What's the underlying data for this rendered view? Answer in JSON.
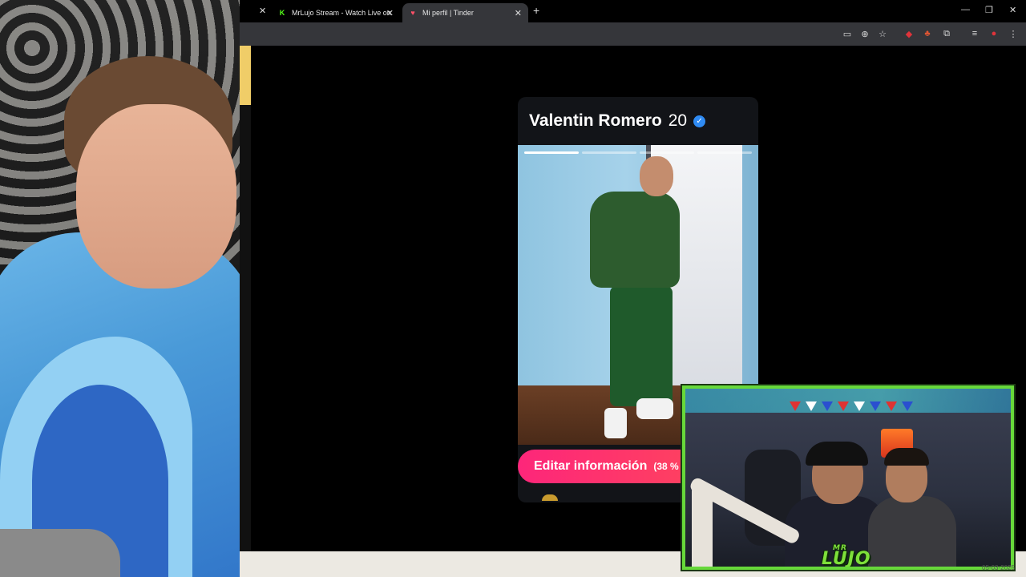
{
  "browser": {
    "tabs": [
      {
        "title": "MrLujo Stream - Watch Live on",
        "icon": "kick-icon",
        "active": false
      },
      {
        "title": "Mi perfil | Tinder",
        "icon": "tinder-icon",
        "active": true
      }
    ],
    "new_tab_label": "+"
  },
  "profile": {
    "name": "Valentin Romero",
    "age": "20",
    "verified": true,
    "edit_button_label": "Editar información",
    "completion": "(38 %"
  },
  "stream_overlay": {
    "logo_small": "MR",
    "logo_text": "LUJO"
  },
  "date_stamp": "05-03-2025",
  "colors": {
    "tinder_gradient_start": "#fd267a",
    "tinder_gradient_end": "#ff4b56",
    "verified_blue": "#2f8bf3",
    "cam_frame_green": "#67d83a"
  }
}
